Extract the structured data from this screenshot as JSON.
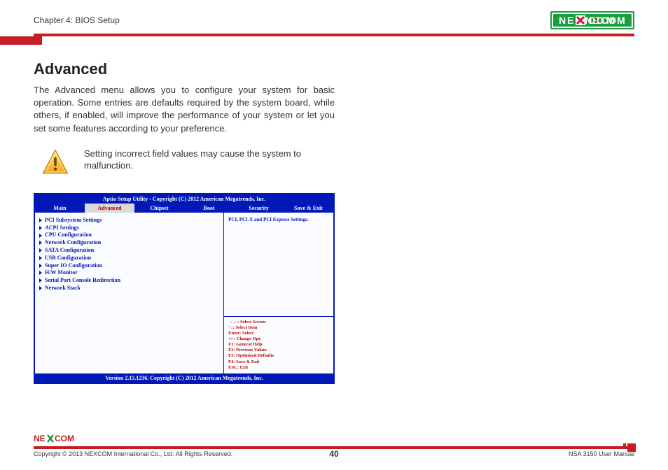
{
  "header": {
    "chapter": "Chapter 4: BIOS Setup",
    "brand": "NEXCOM"
  },
  "page": {
    "title": "Advanced",
    "intro": "The Advanced menu allows you to configure your system for basic operation. Some entries are defaults required by the system board, while others, if enabled, will improve the performance of your system or let you set some features according to your preference.",
    "warning": "Setting incorrect field values may cause the system to malfunction."
  },
  "bios": {
    "title": "Aptio Setup Utility - Copyright (C) 2012 American Megatrends, Inc.",
    "tabs": [
      "Main",
      "Advanced",
      "Chipset",
      "Boot",
      "Security",
      "Save & Exit"
    ],
    "active_tab": "Advanced",
    "items": [
      "PCI Subsystem Settings",
      "ACPI Settings",
      "CPU Configuration",
      "Network Configuration",
      "SATA Configuration",
      "USB Configuration",
      "Super IO Configuration",
      "H/W Monitor",
      "Serial Port Console Redirection",
      "Network Stack"
    ],
    "help": "PCI, PCI-X and PCI Express Settings.",
    "keys": [
      "→←: Select Screen",
      "↑↓: Select Item",
      "Enter: Select",
      "+/-: Change Opt.",
      "F1: General Help",
      "F2: Previous Values",
      "F3: Optimized Defaults",
      "F4: Save & Exit",
      "ESC: Exit"
    ],
    "footer": "Version 2.15.1236. Copyright (C) 2012 American Megatrends, Inc."
  },
  "footer": {
    "copyright": "Copyright © 2013 NEXCOM International Co., Ltd. All Rights Reserved.",
    "page": "40",
    "manual": "NSA 3150 User Manual"
  }
}
